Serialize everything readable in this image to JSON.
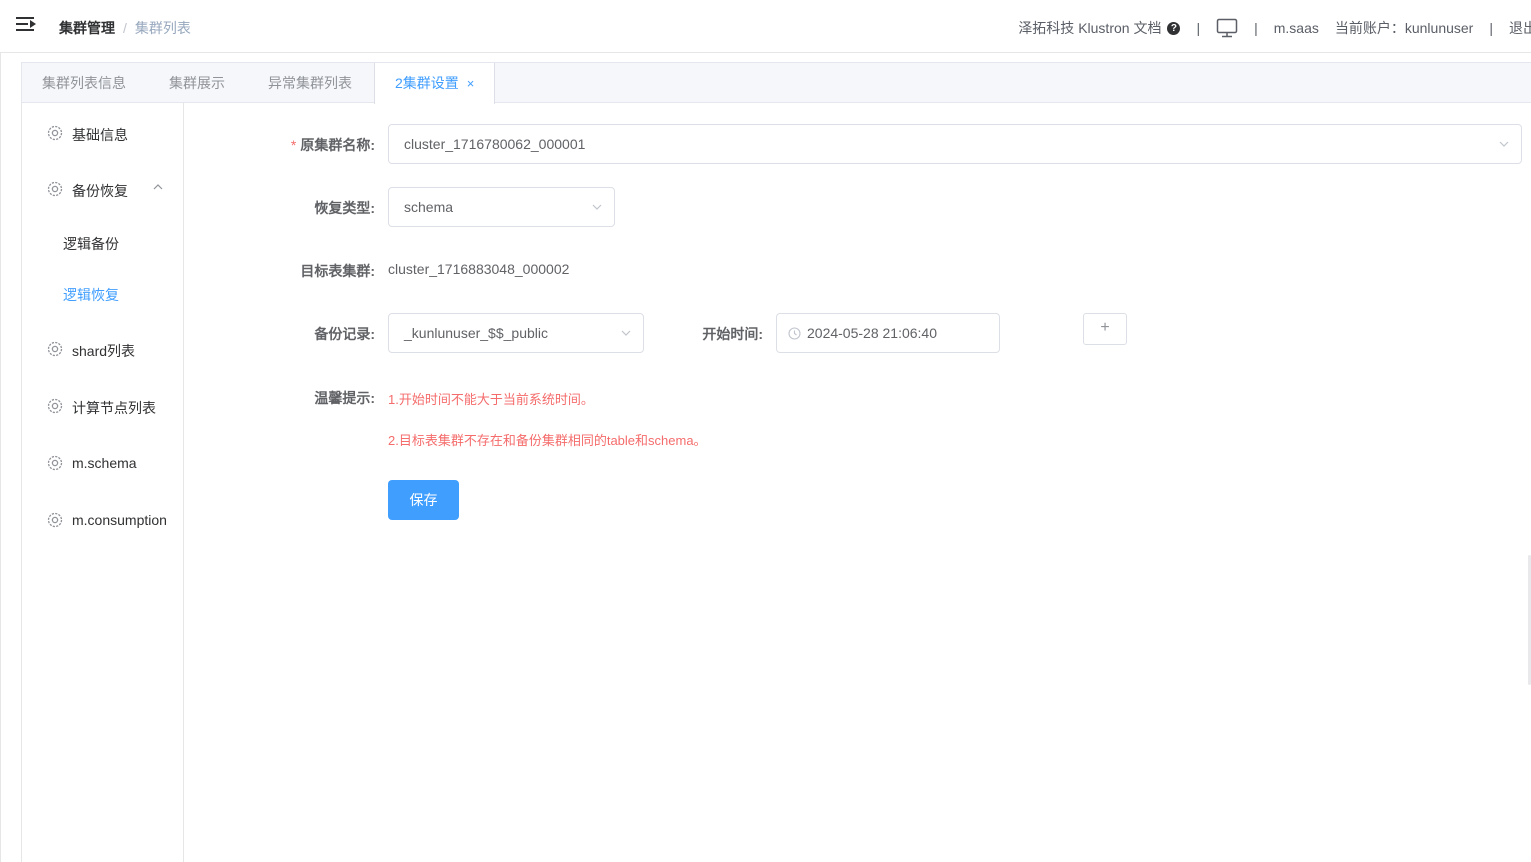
{
  "header": {
    "breadcrumb": [
      "集群管理",
      "集群列表"
    ],
    "breadcrumb_sep": "/",
    "brand_docs": "泽拓科技 Klustron 文档",
    "help_glyph": "?",
    "pipe": "|",
    "saas": "m.saas",
    "account_label": "当前账户：",
    "account_name": "kunlunuser",
    "logout": "退出登录"
  },
  "tabs": [
    {
      "label": "集群列表信息"
    },
    {
      "label": "集群展示"
    },
    {
      "label": "异常集群列表"
    },
    {
      "label": "2集群设置",
      "close": "×",
      "active": true
    }
  ],
  "sidebar": {
    "items": [
      {
        "label": "基础信息",
        "icon": "gear-icon"
      },
      {
        "label": "备份恢复",
        "icon": "gear-icon",
        "expanded": true
      },
      {
        "label": "shard列表",
        "icon": "gear-icon"
      },
      {
        "label": "计算节点列表",
        "icon": "gear-icon"
      },
      {
        "label": "m.schema",
        "icon": "gear-icon"
      },
      {
        "label": "m.consumption",
        "icon": "gear-icon"
      }
    ],
    "sub_items": [
      {
        "label": "逻辑备份"
      },
      {
        "label": "逻辑恢复",
        "active": true
      }
    ]
  },
  "form": {
    "source_cluster_label": "原集群名称:",
    "required_mark": "*",
    "source_cluster_value": "cluster_1716780062_000001",
    "restore_type_label": "恢复类型:",
    "restore_type_value": "schema",
    "target_cluster_label": "目标表集群:",
    "target_cluster_value": "cluster_1716883048_000002",
    "backup_record_label": "备份记录:",
    "backup_record_value": "_kunlunuser_$$_public",
    "start_time_label": "开始时间:",
    "start_time_value": "2024-05-28 21:06:40",
    "add_button": "+",
    "tip_label": "温馨提示:",
    "tip_1": "1.开始时间不能大于当前系统时间。",
    "tip_2": "2.目标表集群不存在和备份集群相同的table和schema。",
    "save_button": "保存"
  },
  "colors": {
    "accent": "#409eff",
    "danger": "#f56c6c",
    "border": "#dcdfe6"
  }
}
